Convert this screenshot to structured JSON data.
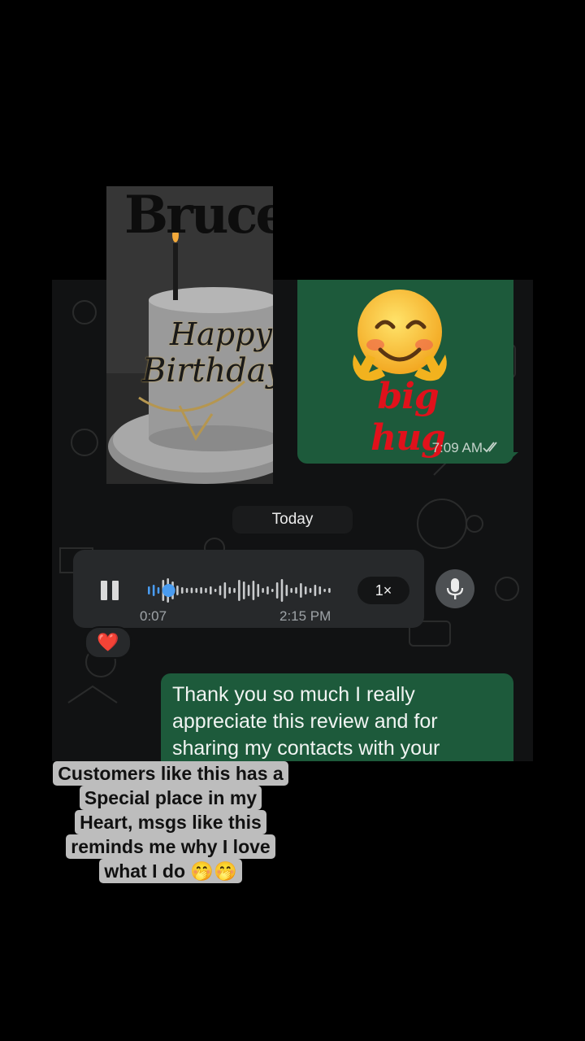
{
  "cake_photo": {
    "name_topper": "Bruce",
    "topper_line1": "Happy",
    "topper_line2": "Birthday"
  },
  "outgoing_sticker": {
    "sticker_emoji": "smiling-hugging-face",
    "sticker_text": "big hug",
    "time": "7:09 AM",
    "status_icon": "double-check-icon"
  },
  "date_divider": "Today",
  "voice_message": {
    "duration": "0:07",
    "time": "2:15 PM",
    "speed": "1×",
    "playback_progress": 0.06
  },
  "reaction": "❤️",
  "text_message": "Thank you so much I really appreciate this review and for sharing my contacts with your",
  "caption_lines": [
    "Customers like this has a",
    "Special place in my",
    "Heart, msgs like this",
    "reminds me why I love",
    "what I do 🤭🤭"
  ],
  "colors": {
    "outgoing_bubble": "#1d5a3b",
    "incoming_bubble": "#27292b",
    "chat_background": "#111213",
    "accent_blue": "#4a9cf0"
  }
}
